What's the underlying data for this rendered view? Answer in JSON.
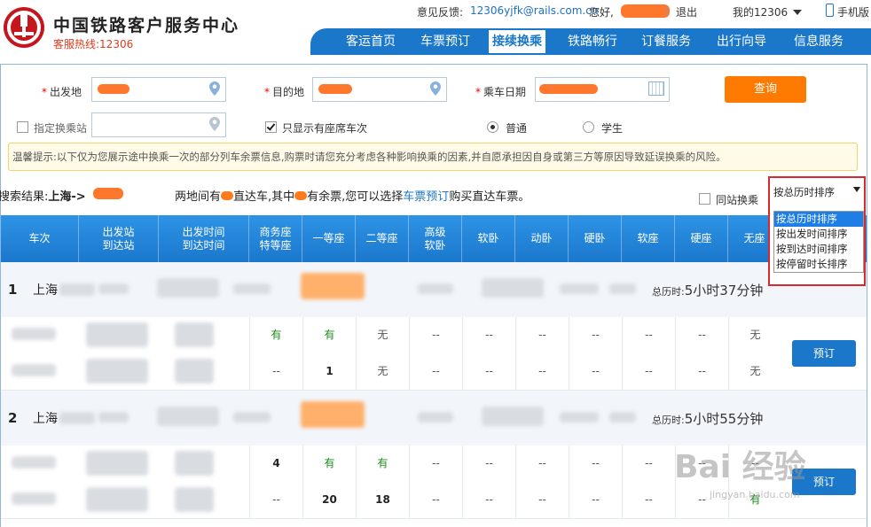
{
  "header": {
    "site_title": "中国铁路客户服务中心",
    "hotline": "客服热线:12306",
    "feedback_label": "意见反馈:",
    "feedback_email": "12306yjfk@rails.com.cn",
    "greeting": "您好,",
    "logout": "退出",
    "my12306": "我的12306",
    "mobile": "手机版"
  },
  "nav": {
    "items": [
      "客运首页",
      "车票预订",
      "接续换乘",
      "铁路畅行",
      "订餐服务",
      "出行向导",
      "信息服务"
    ],
    "active": "接续换乘"
  },
  "search": {
    "from_label": "出发地",
    "to_label": "目的地",
    "date_label": "乘车日期",
    "query_button": "查询",
    "transfer_station_label": "指定换乘站",
    "only_seats_label": "只显示有座席车次",
    "ticket_type_normal": "普通",
    "ticket_type_student": "学生"
  },
  "tips": "温馨提示:以下仅为您展示途中换乘一次的部分列车余票信息,购票时请您充分考虑各种影响换乘的因素,并自愿承担因自身或第三方等原因导致延误换乘的风险。",
  "result": {
    "prefix": "搜索结果:",
    "from": "上海",
    "arrow": "->",
    "text_a": "两地间有",
    "text_b": "直达车,其中",
    "text_c": "有余票,您可以选择",
    "link": "车票预订",
    "text_d": "购买直达车票。",
    "same_station_label": "同站换乘"
  },
  "sort": {
    "selected": "按总历时排序",
    "options": [
      "按总历时排序",
      "按出发时间排序",
      "按到达时间排序",
      "按停留时长排序"
    ]
  },
  "table": {
    "headers": [
      [
        "车次"
      ],
      [
        "出发站",
        "到达站"
      ],
      [
        "出发时间",
        "到达时间"
      ],
      [
        "商务座",
        "特等座"
      ],
      [
        "一等座"
      ],
      [
        "二等座"
      ],
      [
        "高级",
        "软卧"
      ],
      [
        "软卧"
      ],
      [
        "动卧"
      ],
      [
        "硬卧"
      ],
      [
        "软座"
      ],
      [
        "硬座"
      ],
      [
        "无座"
      ]
    ],
    "groups": [
      {
        "index": "1",
        "from_city": "上海",
        "duration_label": "总历时:",
        "duration": "5小时37分钟",
        "book_label": "预订",
        "rows": [
          [
            "有",
            "有",
            "无",
            "--",
            "--",
            "--",
            "--",
            "--",
            "--",
            "无"
          ],
          [
            "--",
            "1",
            "无",
            "--",
            "--",
            "--",
            "--",
            "--",
            "--",
            "无"
          ]
        ]
      },
      {
        "index": "2",
        "from_city": "上海",
        "duration_label": "总历时:",
        "duration": "5小时55分钟",
        "book_label": "预订",
        "rows": [
          [
            "4",
            "有",
            "有",
            "--",
            "--",
            "--",
            "--",
            "--",
            "--",
            "--"
          ],
          [
            "--",
            "20",
            "18",
            "--",
            "--",
            "--",
            "--",
            "--",
            "--",
            "有"
          ]
        ]
      }
    ]
  },
  "watermark": {
    "brand": "Bai 经验",
    "url": "jingyan.baidu.com"
  },
  "colors": {
    "nav_blue": "#1a77c9",
    "query_orange": "#ff7a00",
    "highlight_red": "#d9292e",
    "available_green": "#1c8a1c"
  }
}
